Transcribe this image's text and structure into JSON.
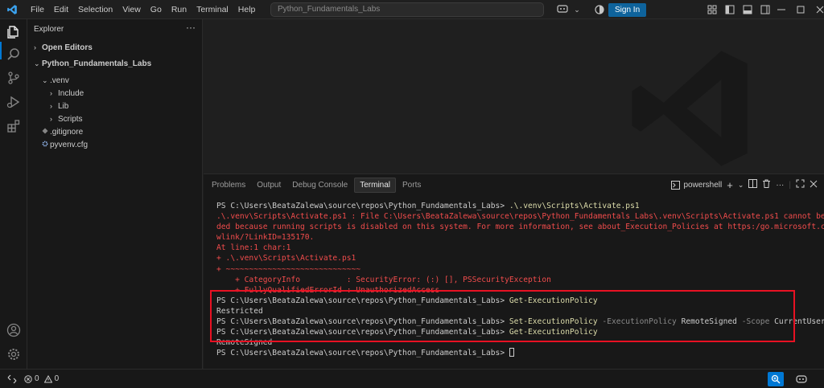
{
  "titlebar": {
    "menu": [
      "File",
      "Edit",
      "Selection",
      "View",
      "Go",
      "Run",
      "Terminal",
      "Help"
    ],
    "search_text": "Python_Fundamentals_Labs",
    "sign_in_label": "Sign In"
  },
  "sidebar": {
    "title": "Explorer",
    "open_editors": "Open Editors",
    "project": "Python_Fundamentals_Labs",
    "tree": [
      {
        "label": ".venv",
        "indent": 1,
        "expanded": true
      },
      {
        "label": "Include",
        "indent": 2,
        "expanded": false
      },
      {
        "label": "Lib",
        "indent": 2,
        "expanded": false
      },
      {
        "label": "Scripts",
        "indent": 2,
        "expanded": false
      },
      {
        "label": ".gitignore",
        "indent": 1,
        "icon": "git-icon"
      },
      {
        "label": "pyvenv.cfg",
        "indent": 1,
        "icon": "gear-icon"
      }
    ]
  },
  "panel": {
    "tabs": [
      "Problems",
      "Output",
      "Debug Console",
      "Terminal",
      "Ports"
    ],
    "active_tab": "Terminal",
    "shell_label": "powershell"
  },
  "terminal": {
    "lines": [
      {
        "kind": "cmd",
        "prompt": "PS C:\\Users\\BeataZalewa\\source\\repos\\Python_Fundamentals_Labs> ",
        "parts": [
          {
            "t": ".\\.venv\\Scripts\\Activate.ps1",
            "c": "cmd"
          }
        ]
      },
      {
        "kind": "err",
        "text": ".\\.venv\\Scripts\\Activate.ps1 : File C:\\Users\\BeataZalewa\\source\\repos\\Python_Fundamentals_Labs\\.venv\\Scripts\\Activate.ps1 cannot be loa"
      },
      {
        "kind": "err",
        "text": "ded because running scripts is disabled on this system. For more information, see about_Execution_Policies at https:/go.microsoft.com/f"
      },
      {
        "kind": "err",
        "text": "wlink/?LinkID=135170."
      },
      {
        "kind": "err",
        "text": "At line:1 char:1"
      },
      {
        "kind": "err",
        "text": "+ .\\.venv\\Scripts\\Activate.ps1"
      },
      {
        "kind": "err",
        "text": "+ ~~~~~~~~~~~~~~~~~~~~~~~~~~~~~"
      },
      {
        "kind": "err",
        "text": "    + CategoryInfo          : SecurityError: (:) [], PSSecurityException"
      },
      {
        "kind": "err",
        "text": "    + FullyQualifiedErrorId : UnauthorizedAccess"
      },
      {
        "kind": "cmd",
        "prompt": "PS C:\\Users\\BeataZalewa\\source\\repos\\Python_Fundamentals_Labs> ",
        "parts": [
          {
            "t": "Get-ExecutionPolicy",
            "c": "cmd"
          }
        ]
      },
      {
        "kind": "out",
        "text": "Restricted"
      },
      {
        "kind": "cmd",
        "prompt": "PS C:\\Users\\BeataZalewa\\source\\repos\\Python_Fundamentals_Labs> ",
        "parts": [
          {
            "t": "Set-ExecutionPolicy",
            "c": "cmd"
          },
          {
            "t": " -ExecutionPolicy ",
            "c": "param"
          },
          {
            "t": "RemoteSigned",
            "c": "plain"
          },
          {
            "t": " -Scope ",
            "c": "param"
          },
          {
            "t": "CurrentUser",
            "c": "plain"
          }
        ]
      },
      {
        "kind": "cmd",
        "prompt": "PS C:\\Users\\BeataZalewa\\source\\repos\\Python_Fundamentals_Labs> ",
        "parts": [
          {
            "t": "Get-ExecutionPolicy",
            "c": "cmd"
          }
        ]
      },
      {
        "kind": "out",
        "text": "RemoteSigned"
      },
      {
        "kind": "cmd",
        "prompt": "PS C:\\Users\\BeataZalewa\\source\\repos\\Python_Fundamentals_Labs> ",
        "parts": [],
        "cursor": true
      }
    ]
  },
  "statusbar": {
    "errors": "0",
    "warnings": "0"
  },
  "colors": {
    "accent": "#0078d4",
    "error_text": "#f14c4c",
    "command_text": "#dcdcaa",
    "highlight_box": "#e81123"
  }
}
